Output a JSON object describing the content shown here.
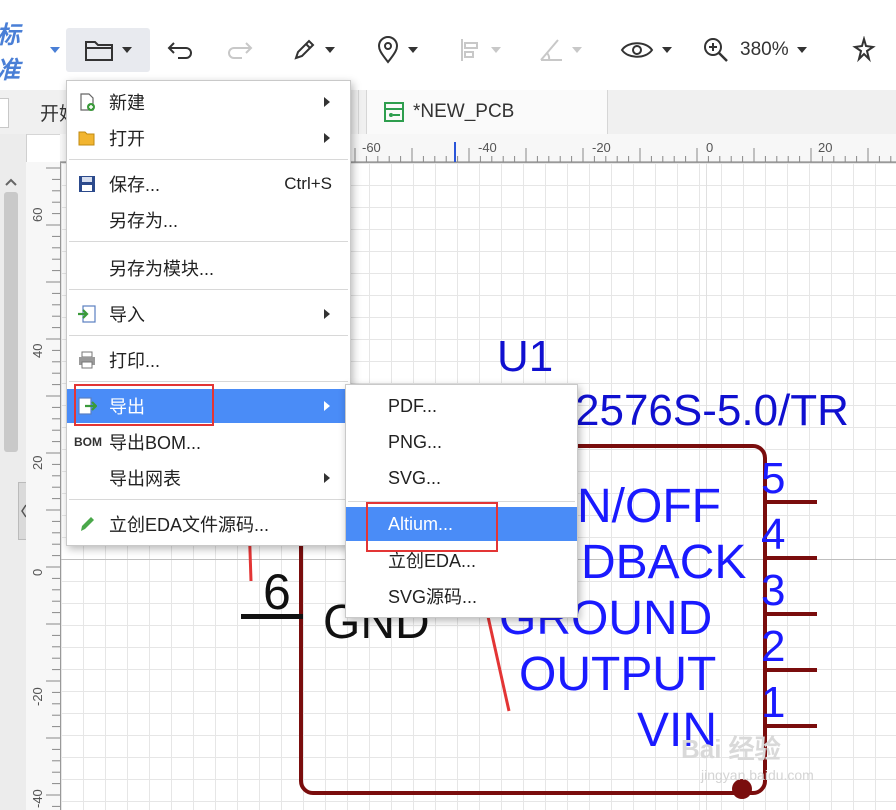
{
  "toolbar": {
    "partial_title": "标准",
    "zoom": "380%"
  },
  "tabs": [
    {
      "label": "开始"
    },
    {
      "label": "*NEW_PCB"
    }
  ],
  "hruler": {
    "ticks": [
      "-60",
      "-40",
      "-20",
      "0",
      "20"
    ]
  },
  "vruler": {
    "ticks": [
      "60",
      "40",
      "20",
      "0",
      "-20",
      "-40"
    ]
  },
  "file_menu": {
    "items": [
      {
        "label": "新建",
        "submenu": true
      },
      {
        "label": "打开",
        "submenu": true
      },
      {
        "label": "保存...",
        "shortcut": "Ctrl+S"
      },
      {
        "label": "另存为..."
      },
      {
        "label": "另存为模块..."
      },
      {
        "label": "导入",
        "submenu": true
      },
      {
        "label": "打印..."
      },
      {
        "label": "导出",
        "submenu": true,
        "highlighted": true
      },
      {
        "label": "导出BOM...",
        "icon_text": "BOM"
      },
      {
        "label": "导出网表",
        "submenu": true
      },
      {
        "label": "立创EDA文件源码..."
      }
    ]
  },
  "export_menu": {
    "items": [
      {
        "label": "PDF..."
      },
      {
        "label": "PNG..."
      },
      {
        "label": "SVG..."
      },
      {
        "label": "Altium...",
        "highlighted": true
      },
      {
        "label": "立创EDA..."
      },
      {
        "label": "SVG源码..."
      }
    ]
  },
  "schematic": {
    "designator": "U1",
    "part": "2576S-5.0/TR",
    "pins_right": [
      {
        "num": "5",
        "name": "N/OFF"
      },
      {
        "num": "4",
        "name": "DBACK"
      },
      {
        "num": "3",
        "name": "GROUND"
      },
      {
        "num": "2",
        "name": "OUTPUT"
      },
      {
        "num": "1",
        "name": "VIN"
      }
    ],
    "pin_left": {
      "num": "6",
      "name": "GND"
    }
  },
  "watermark": {
    "brand": "Bai 经验",
    "url": "jingyan.baidu.com"
  },
  "colors": {
    "accent": "#4a8cf7",
    "annotation": "#e33535",
    "schematic_blue": "#1a1aff",
    "body": "#7a0d0d"
  }
}
